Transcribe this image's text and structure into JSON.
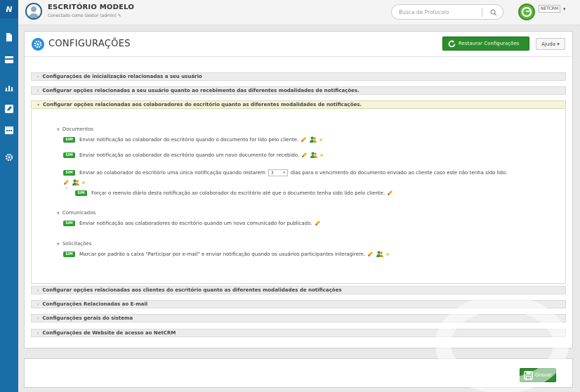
{
  "header": {
    "office_name": "ESCRITÓRIO MODELO",
    "office_sub": "Conectado como Gestor (admin) ✎",
    "search_placeholder": "Busca de Protocolo",
    "brand_text": "NETCRM",
    "caret": "▾"
  },
  "sidebar": {
    "logo": "N",
    "icons": [
      "file-icon",
      "card-icon",
      "chart-icon",
      "edit-icon",
      "calendar-icon",
      "gear-icon"
    ]
  },
  "page": {
    "title": "CONFIGURAÇÕES",
    "restore_label": "Restaurar Configurações",
    "help_label": "Ajuda ▾"
  },
  "accordion": [
    {
      "label": "Configurações de inicialização relacionadas a seu usuário",
      "open": false
    },
    {
      "label": "Configurar opções relacionadas a seu usuário quanto ao recebimento das diferentes modalidades de notificações.",
      "open": false
    },
    {
      "label": "Configurar opções relacionadas aos colaboradores do escritório quanto as diferentes modalidades de notificações.",
      "open": true
    },
    {
      "label": "Configurar opções relacionadas aos clientes do escritório quanto as diferentes modalidades de notificações",
      "open": false
    },
    {
      "label": "Configurações Relacionadas ao E-mail",
      "open": false
    },
    {
      "label": "Configurações gerais do sistema",
      "open": false
    },
    {
      "label": "Configurações de Website de acesso ao NetCRM",
      "open": false
    }
  ],
  "sections": {
    "documentos": {
      "title": "Documentos",
      "items": [
        "Enviar notificação ao colaborador do escritório quando o documento for lido pelo cliente.",
        "Enviar notificação ao colaborador do escritório quando um novo documento for recebido.",
        "Enviar ao colaborador do escritório uma única notificação quando restarem"
      ],
      "days_value": "3",
      "days_suffix": "dias para o vencimento do documento enviado ao cliente caso este não tenha sido lido.",
      "sub_item": "Forçar o reenvio diário desta notificação ao colaborador do escritório até que o documento tenha sido lido pelo cliente."
    },
    "comunicados": {
      "title": "Comunicados",
      "item": "Enviar notificação aos colaboradores do escritório quando um novo comunicado for publicado."
    },
    "solicitacoes": {
      "title": "Solicitações",
      "item": "Marcar por padrão a caixa \"Participar por e-mail\" e enviar notificação quando os usuários participantes interagirem."
    },
    "toggle_label": "SIM"
  },
  "footer": {
    "save_label": "Gravar"
  },
  "colors": {
    "sidebar": "#1a6ea8",
    "success": "#2a8f2a",
    "accent_blue": "#2b8fd6",
    "open_row": "#f6f4dd"
  }
}
